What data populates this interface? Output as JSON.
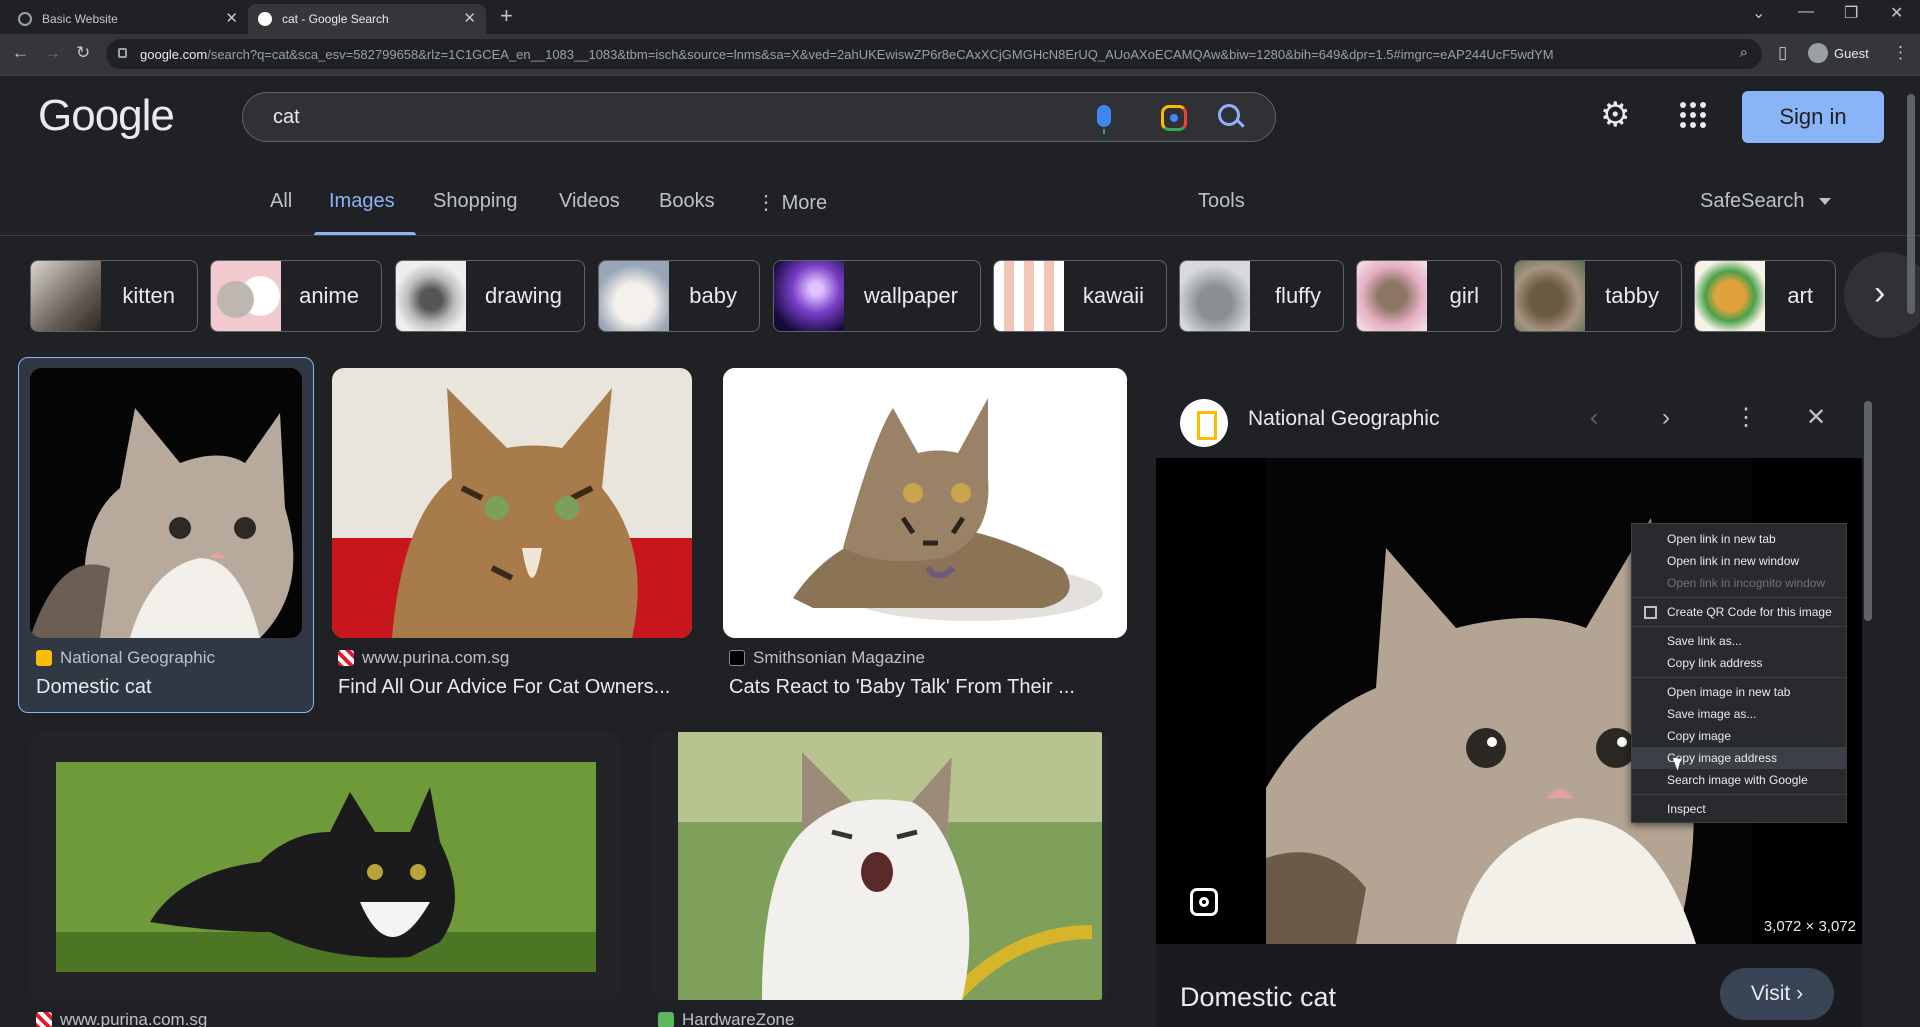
{
  "browser": {
    "tabs": [
      {
        "title": "Basic Website",
        "active": false
      },
      {
        "title": "cat - Google Search",
        "active": true
      }
    ],
    "url_domain": "google.com",
    "url_rest": "/search?q=cat&sca_esv=582799658&rlz=1C1GCEA_en__1083__1083&tbm=isch&source=lnms&sa=X&ved=2ahUKEwiswZP6r8eCAxXCjGMGHcN8ErUQ_AUoAXoECAMQAw&biw=1280&bih=649&dpr=1.5#imgrc=eAP244UcF5wdYM",
    "profile_label": "Guest"
  },
  "google": {
    "logo": "Google",
    "query": "cat",
    "signin_label": "Sign in"
  },
  "nav": {
    "tabs": [
      "All",
      "Images",
      "Shopping",
      "Videos",
      "Books",
      "More"
    ],
    "active": "Images",
    "tools": "Tools",
    "safesearch": "SafeSearch"
  },
  "chips": [
    "kitten",
    "anime",
    "drawing",
    "baby",
    "wallpaper",
    "kawaii",
    "fluffy",
    "girl",
    "tabby",
    "art"
  ],
  "results": [
    {
      "source": "National Geographic",
      "title": "Domestic cat"
    },
    {
      "source": "www.purina.com.sg",
      "title": "Find All Our Advice For Cat Owners..."
    },
    {
      "source": "Smithsonian Magazine",
      "title": "Cats React to 'Baby Talk' From Their ..."
    },
    {
      "source": "www.purina.com.sg",
      "title": ""
    },
    {
      "source": "HardwareZone",
      "title": ""
    }
  ],
  "preview": {
    "source": "National Geographic",
    "title": "Domestic cat",
    "dimensions": "3,072 × 3,072",
    "visit_label": "Visit"
  },
  "context_menu": {
    "group1": [
      "Open link in new tab",
      "Open link in new window",
      "Open link in incognito window"
    ],
    "qr": "Create QR Code for this image",
    "group2": [
      "Save link as...",
      "Copy link address"
    ],
    "group3": [
      "Open image in new tab",
      "Save image as...",
      "Copy image",
      "Copy image address",
      "Search image with Google"
    ],
    "inspect": "Inspect",
    "highlighted": "Copy image address"
  },
  "colors": {
    "accent": "#8ab4f8",
    "background": "#202124"
  }
}
